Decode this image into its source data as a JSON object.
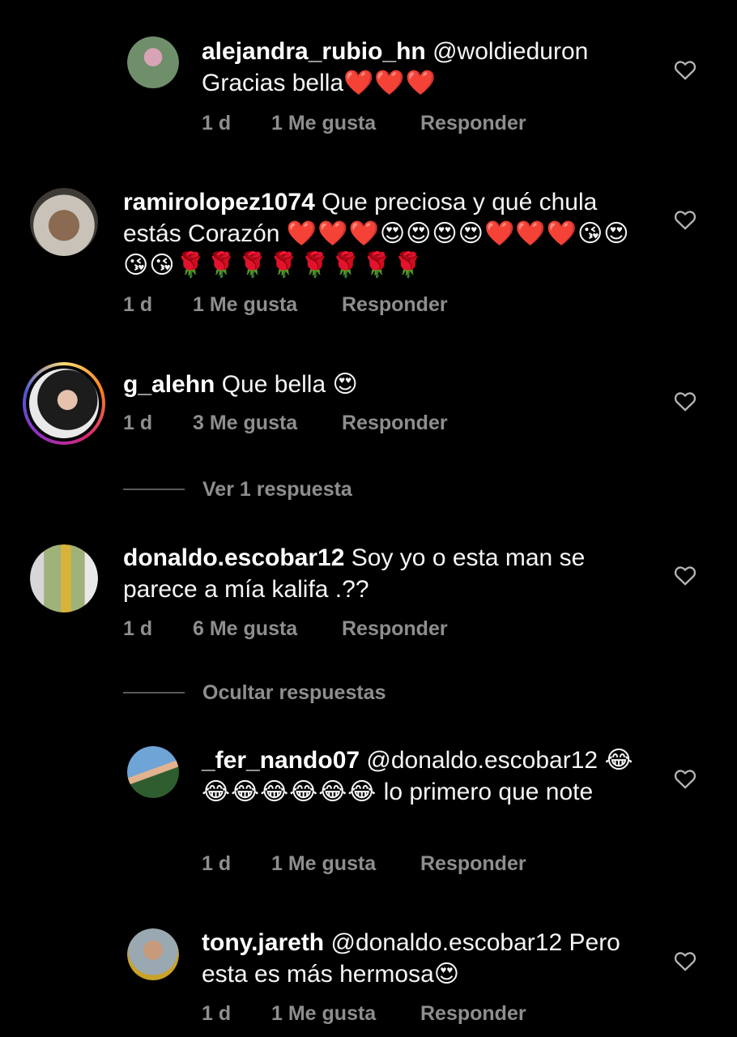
{
  "comments": [
    {
      "username": "alejandra_rubio_hn",
      "mention": "@woldieduron",
      "text": "Gracias bella",
      "emojis": "❤️❤️❤️",
      "time": "1 d",
      "likes": "1 Me gusta",
      "reply": "Responder",
      "avatar_colors": [
        "#6f8f6a",
        "#d9a3b6"
      ]
    },
    {
      "username": "ramirolopez1074",
      "text": "Que preciosa y qué chula estás Corazón",
      "emojis": "❤️❤️❤️😍😍😍😍❤️❤️❤️😘😍😘😘🌹🌹🌹🌹🌹🌹🌹🌹",
      "time": "1 d",
      "likes": "1 Me gusta",
      "reply": "Responder",
      "avatar_colors": [
        "#c9c2b8",
        "#5b4636"
      ]
    },
    {
      "username": "g_alehn",
      "text": "Que bella",
      "emojis": "😍",
      "time": "1 d",
      "likes": "3 Me gusta",
      "reply": "Responder",
      "avatar_colors": [
        "#e9e9ea",
        "#1c1c1c"
      ]
    },
    {
      "username": "donaldo.escobar12",
      "text": "Soy yo o esta man se parece a mía kalifa .??",
      "time": "1 d",
      "likes": "6 Me gusta",
      "reply": "Responder",
      "avatar_colors": [
        "#9fb27a",
        "#d9b23a"
      ]
    },
    {
      "username": "_fer_nando07",
      "mention": "@donaldo.escobar12",
      "emojis": "😂😂😂😂😂😂😂",
      "text": "lo primero que note",
      "time": "1 d",
      "likes": "1 Me gusta",
      "reply": "Responder",
      "avatar_colors": [
        "#6fa4d6",
        "#2f5d2f"
      ]
    },
    {
      "username": "tony.jareth",
      "mention": "@donaldo.escobar12",
      "text": "Pero esta es más hermosa",
      "emojis": "😍",
      "time": "1 d",
      "likes": "1 Me gusta",
      "reply": "Responder",
      "avatar_colors": [
        "#9aa8b2",
        "#c9a227"
      ]
    }
  ],
  "threads": {
    "view_replies": "Ver 1 respuesta",
    "hide_replies": "Ocultar respuestas"
  }
}
